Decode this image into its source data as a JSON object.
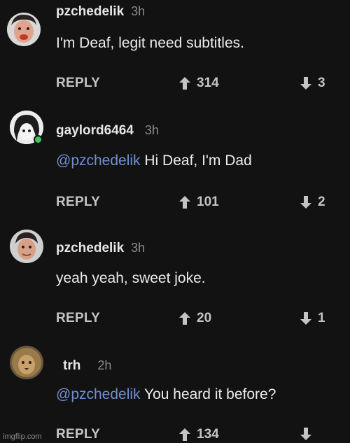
{
  "comments": [
    {
      "username": "pzchedelik",
      "time": "3h",
      "mention": "",
      "text": "I'm Deaf, legit need subtitles.",
      "reply_label": "REPLY",
      "upvotes": "314",
      "downvotes": "3"
    },
    {
      "username": "gaylord6464",
      "time": "3h",
      "mention": "@pzchedelik",
      "text": " Hi Deaf, I'm Dad",
      "reply_label": "REPLY",
      "upvotes": "101",
      "downvotes": "2"
    },
    {
      "username": "pzchedelik",
      "time": "3h",
      "mention": "",
      "text": "yeah yeah, sweet joke.",
      "reply_label": "REPLY",
      "upvotes": "20",
      "downvotes": "1"
    },
    {
      "username": "trh",
      "time": "2h",
      "mention": "@pzchedelik",
      "text": " You heard it before?",
      "reply_label": "REPLY",
      "upvotes": "134",
      "downvotes": ""
    }
  ],
  "icons": {
    "upvote": "arrow-up-icon",
    "downvote": "arrow-down-icon"
  },
  "colors": {
    "background": "#121212",
    "mention": "#6f8fd0",
    "online": "#46c35c"
  },
  "watermark": "imgflip.com"
}
